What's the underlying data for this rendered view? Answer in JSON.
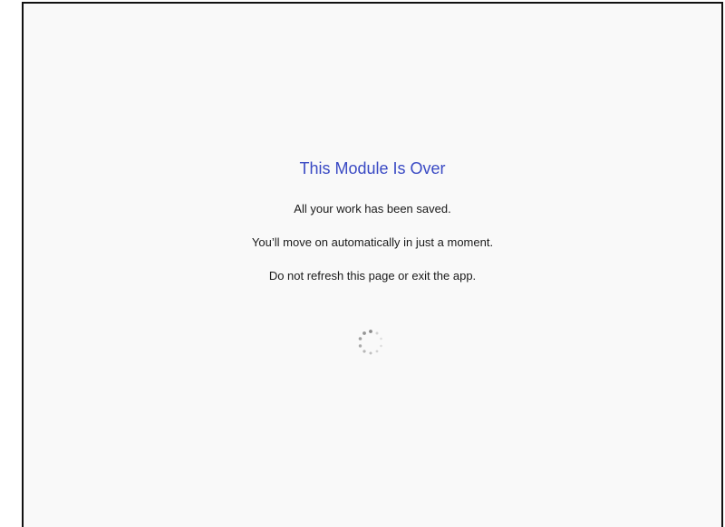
{
  "message": {
    "title": "This Module Is Over",
    "line1": "All your work has been saved.",
    "line2": "You’ll move on automatically in just a moment.",
    "line3": "Do not refresh this page or exit the app."
  },
  "colors": {
    "title": "#3a4ac4",
    "text": "#1a1a1a",
    "background": "#f9f9f9",
    "spinner": "#8a8a8a"
  },
  "icons": {
    "loader": "loading-spinner-icon"
  }
}
